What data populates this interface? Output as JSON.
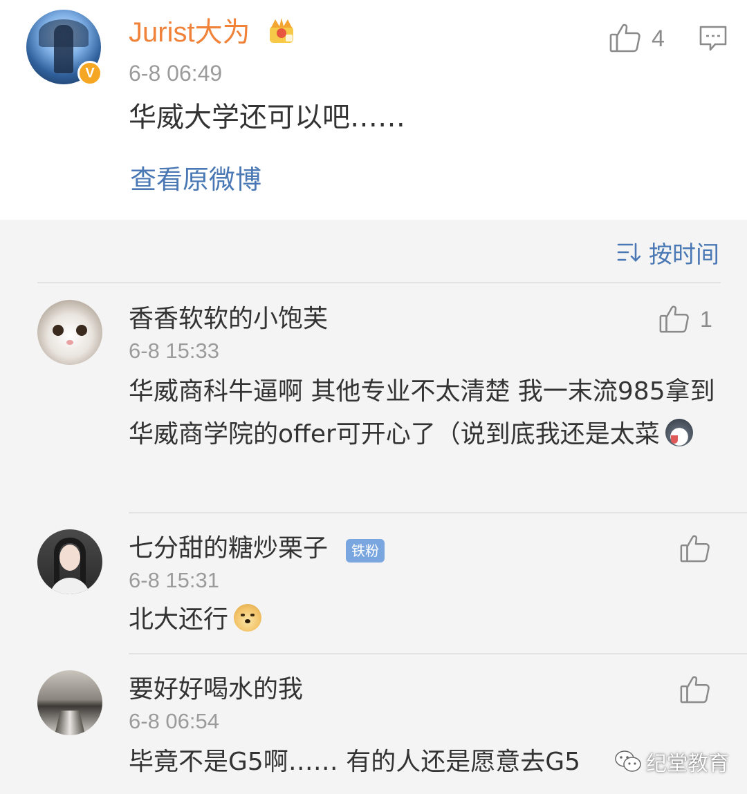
{
  "post": {
    "author": "Jurist大为",
    "time": "6-8 06:49",
    "text": "华威大学还可以吧……",
    "view_original": "查看原微博",
    "like_count": "4",
    "verified_badge": "V",
    "icons": {
      "avatar": "avatar",
      "crown": "crown-icon",
      "like": "thumbs-up-icon",
      "comment": "comment-icon"
    }
  },
  "comments_header": {
    "sort_label": "按时间",
    "sort_icon": "sort-icon"
  },
  "comments": [
    {
      "name": "香香软软的小饱芙",
      "time": "6-8 15:33",
      "text": "华威商科牛逼啊 其他专业不太清楚 我一末流985拿到华威商学院的offer可开心了（说到底我还是太菜",
      "like_count": "1",
      "emoji": "husky-emoji"
    },
    {
      "name": "七分甜的糖炒栗子",
      "badge": "铁粉",
      "time": "6-8 15:31",
      "text": "北大还行",
      "like_count": "",
      "emoji": "doge-emoji"
    },
    {
      "name": "要好好喝水的我",
      "time": "6-8 06:54",
      "text": "毕竟不是G5啊…… 有的人还是愿意去G5",
      "like_count": ""
    }
  ],
  "watermark": {
    "text": "纪堂教育",
    "icon": "wechat-icon"
  },
  "colors": {
    "author_orange": "#f0823a",
    "link_blue": "#4a78b4",
    "badge_blue": "#7aa6e0",
    "vip_gold": "#f5a623"
  }
}
